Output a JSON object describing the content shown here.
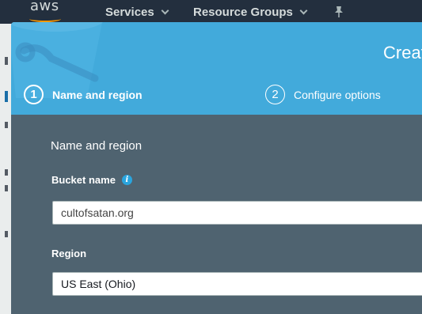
{
  "nav": {
    "logo": "aws",
    "services": "Services",
    "resource_groups": "Resource Groups",
    "pin_icon": "pin-icon"
  },
  "modal": {
    "title": "Create bucket",
    "steps": [
      {
        "number": "1",
        "label": "Name and region",
        "active": true
      },
      {
        "number": "2",
        "label": "Configure options",
        "active": false
      }
    ],
    "section_title": "Name and region",
    "bucket_name": {
      "label": "Bucket name",
      "info_icon": "info-icon",
      "value": "cultofsatan.org"
    },
    "region": {
      "label": "Region",
      "value": "US East (Ohio)"
    }
  },
  "colors": {
    "nav_bg": "#232f3e",
    "header_blue": "#42aadb",
    "modal_body": "#4f6370",
    "accent_orange": "#ff9900"
  }
}
